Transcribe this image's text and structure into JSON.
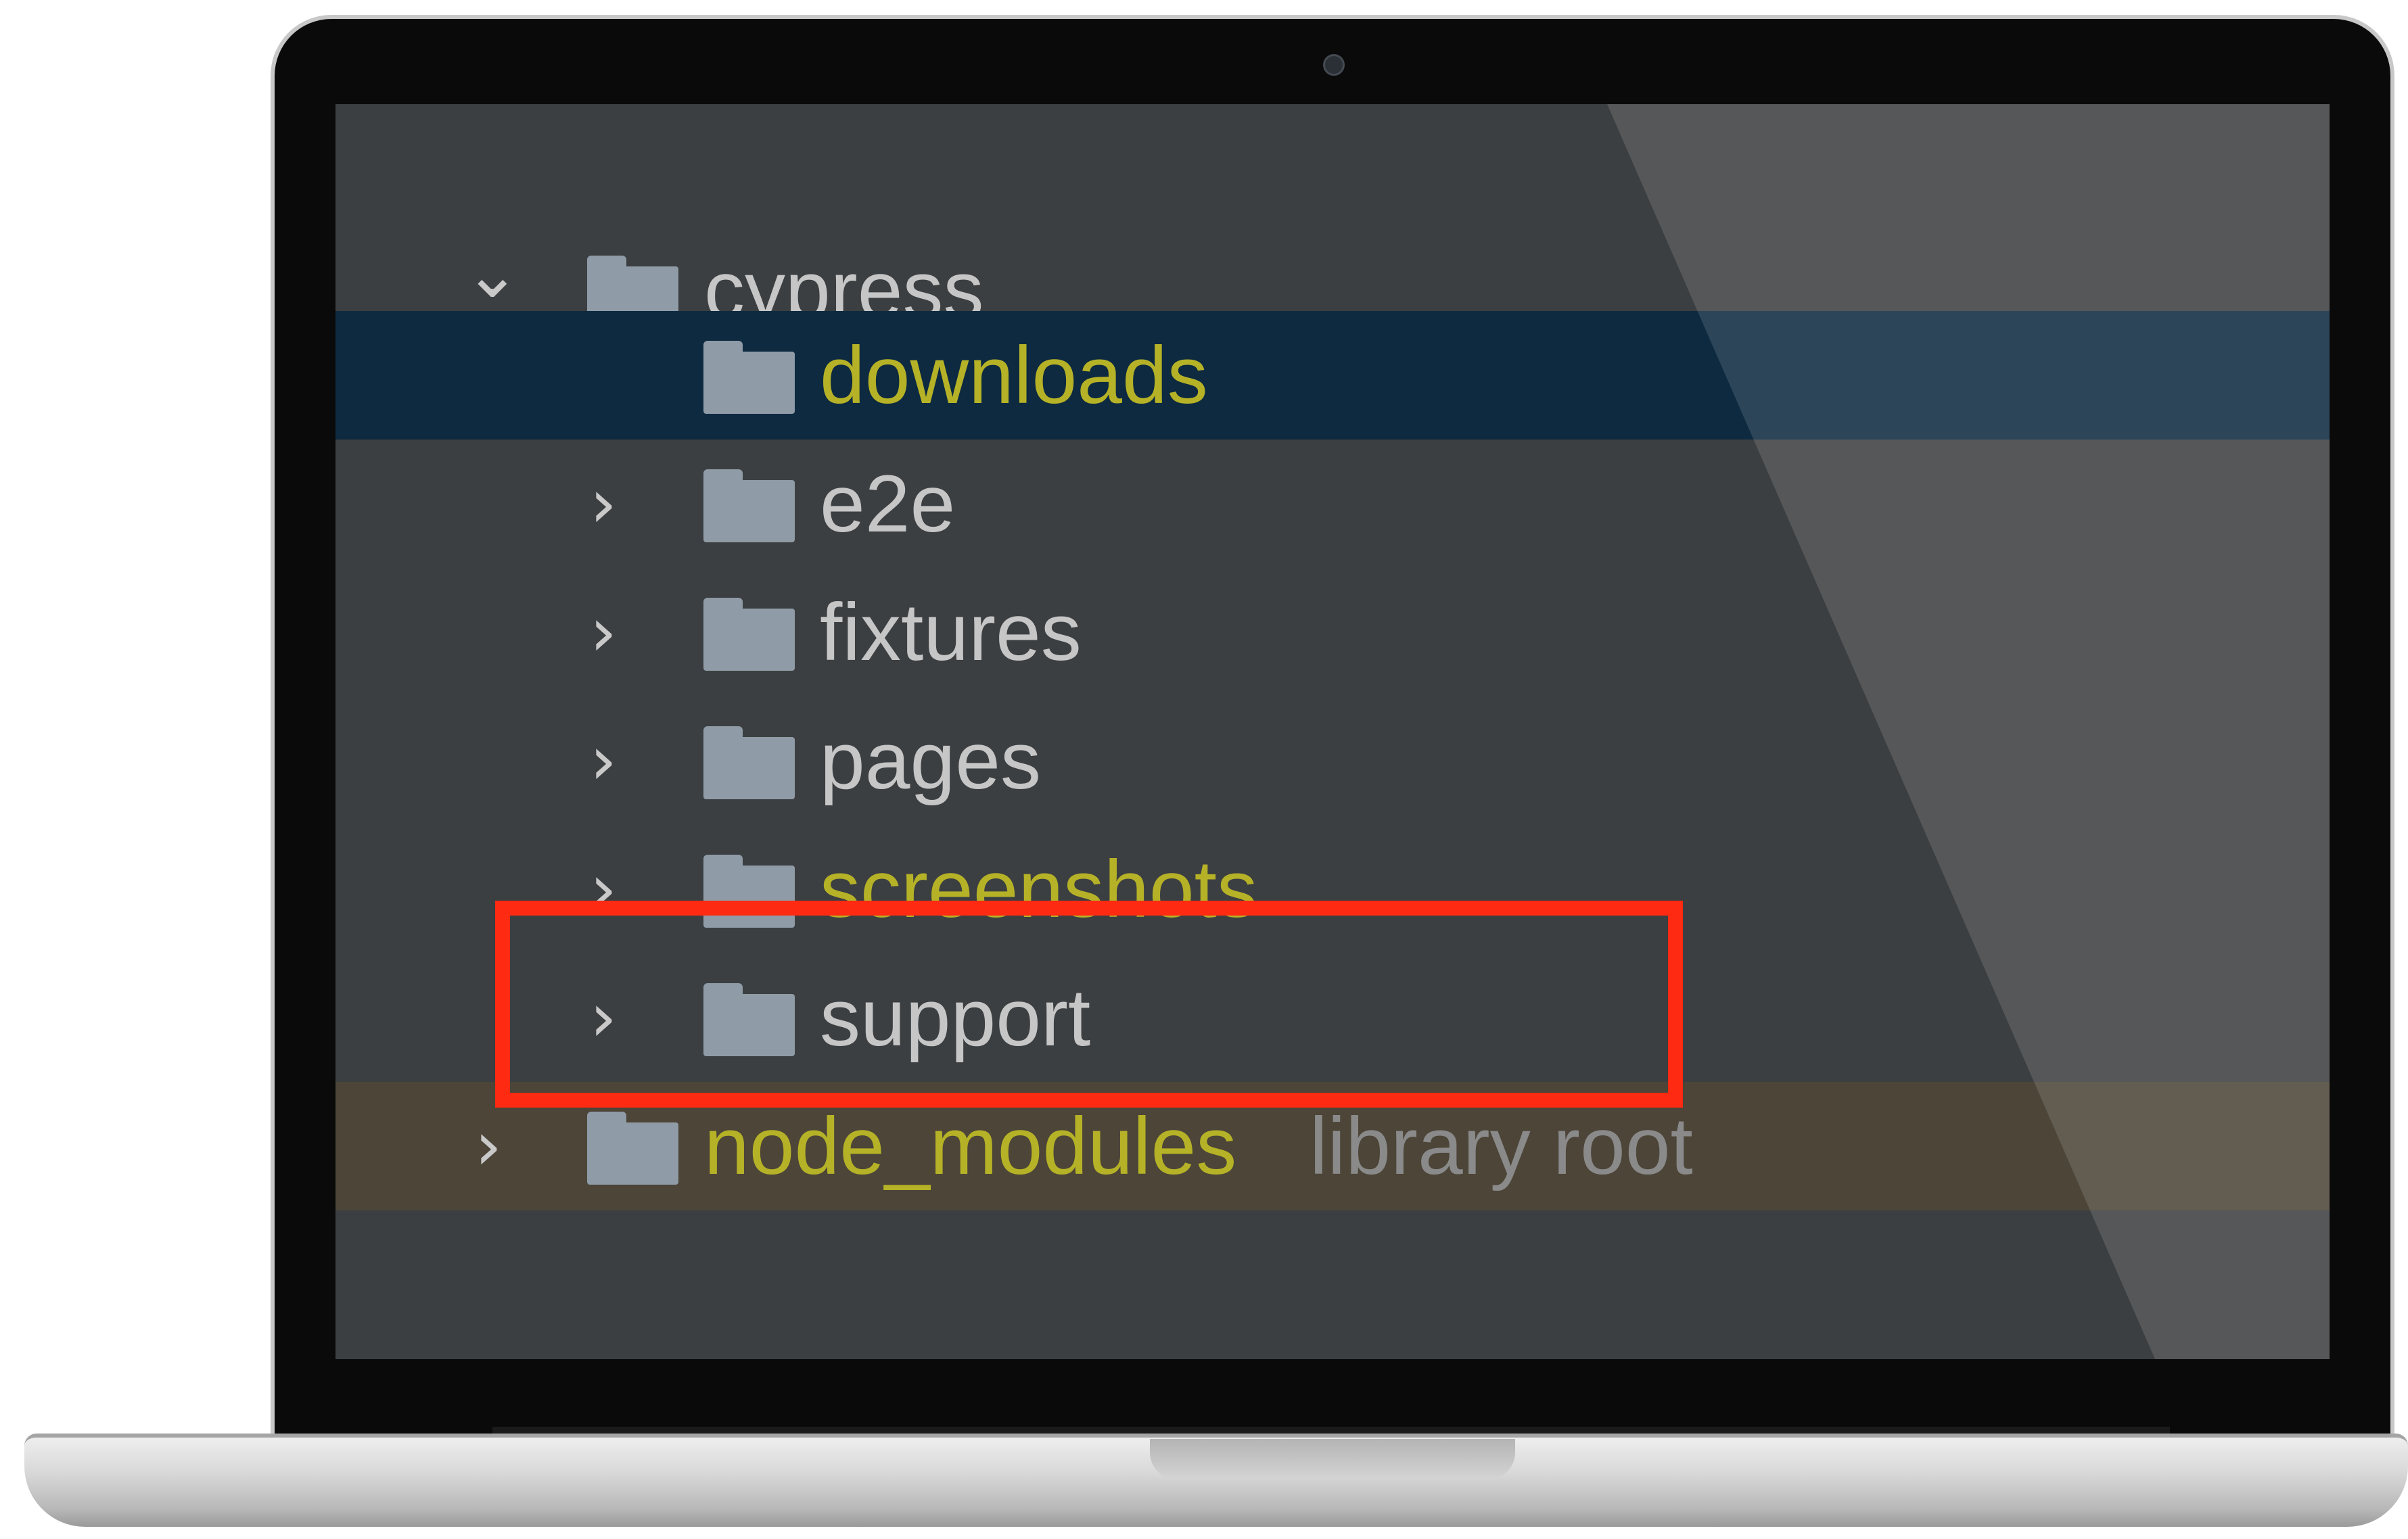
{
  "tree": {
    "rows": [
      {
        "label": "cypress",
        "chevron": "⌄",
        "expanded": true,
        "color": "#c6c6c6"
      },
      {
        "label": "downloads",
        "chevron": "",
        "selected": true,
        "color": "#b6b227"
      },
      {
        "label": "e2e",
        "chevron": "›",
        "color": "#c6c6c6"
      },
      {
        "label": "fixtures",
        "chevron": "›",
        "color": "#c6c6c6"
      },
      {
        "label": "pages",
        "chevron": "›",
        "color": "#c6c6c6"
      },
      {
        "label": "screenshots",
        "chevron": "›",
        "color": "#b6b227"
      },
      {
        "label": "support",
        "chevron": "›",
        "highlighted": true,
        "color": "#c6c6c6"
      },
      {
        "label": "node_modules",
        "suffix": "library root",
        "chevron": "›",
        "color": "#b6b227"
      }
    ]
  },
  "icons": {
    "folder": "folder-icon",
    "chevron_right": "chevron-right-icon",
    "chevron_down": "chevron-down-icon"
  },
  "colors": {
    "screen_bg": "#3c3f41",
    "selection_bg": "#0d2a40",
    "library_bg": "#4c4538",
    "highlight_border": "#ff2a12",
    "folder_icon": "#8f9ba6"
  }
}
